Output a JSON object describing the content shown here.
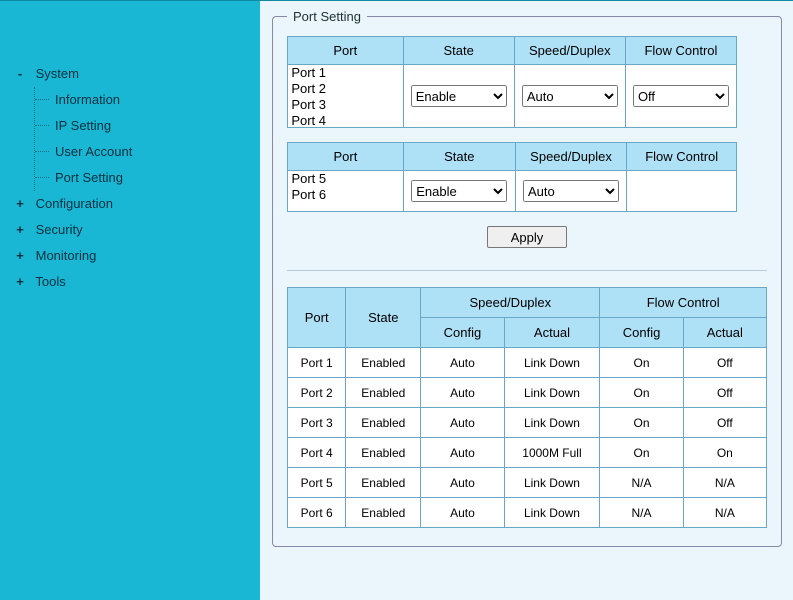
{
  "sidebar": {
    "system": {
      "label": "System",
      "expanded": true,
      "children": [
        "Information",
        "IP Setting",
        "User Account",
        "Port Setting"
      ]
    },
    "items": [
      "Configuration",
      "Security",
      "Monitoring",
      "Tools"
    ]
  },
  "panel_title": "Port Setting",
  "cfg_headers": [
    "Port",
    "State",
    "Speed/Duplex",
    "Flow Control"
  ],
  "cfg1": {
    "ports": [
      "Port 1",
      "Port 2",
      "Port 3",
      "Port 4"
    ],
    "state": "Enable",
    "speed": "Auto",
    "flow": "Off"
  },
  "cfg2": {
    "ports": [
      "Port 5",
      "Port 6"
    ],
    "state": "Enable",
    "speed": "Auto",
    "flow": ""
  },
  "apply_label": "Apply",
  "status_headers": {
    "port": "Port",
    "state": "State",
    "speed": "Speed/Duplex",
    "speed_sub": [
      "Config",
      "Actual"
    ],
    "flow": "Flow Control",
    "flow_sub": [
      "Config",
      "Actual"
    ]
  },
  "status_rows": [
    {
      "port": "Port 1",
      "state": "Enabled",
      "sconf": "Auto",
      "sact": "Link Down",
      "fconf": "On",
      "fact": "Off"
    },
    {
      "port": "Port 2",
      "state": "Enabled",
      "sconf": "Auto",
      "sact": "Link Down",
      "fconf": "On",
      "fact": "Off"
    },
    {
      "port": "Port 3",
      "state": "Enabled",
      "sconf": "Auto",
      "sact": "Link Down",
      "fconf": "On",
      "fact": "Off"
    },
    {
      "port": "Port 4",
      "state": "Enabled",
      "sconf": "Auto",
      "sact": "1000M Full",
      "fconf": "On",
      "fact": "On"
    },
    {
      "port": "Port 5",
      "state": "Enabled",
      "sconf": "Auto",
      "sact": "Link Down",
      "fconf": "N/A",
      "fact": "N/A"
    },
    {
      "port": "Port 6",
      "state": "Enabled",
      "sconf": "Auto",
      "sact": "Link Down",
      "fconf": "N/A",
      "fact": "N/A"
    }
  ]
}
